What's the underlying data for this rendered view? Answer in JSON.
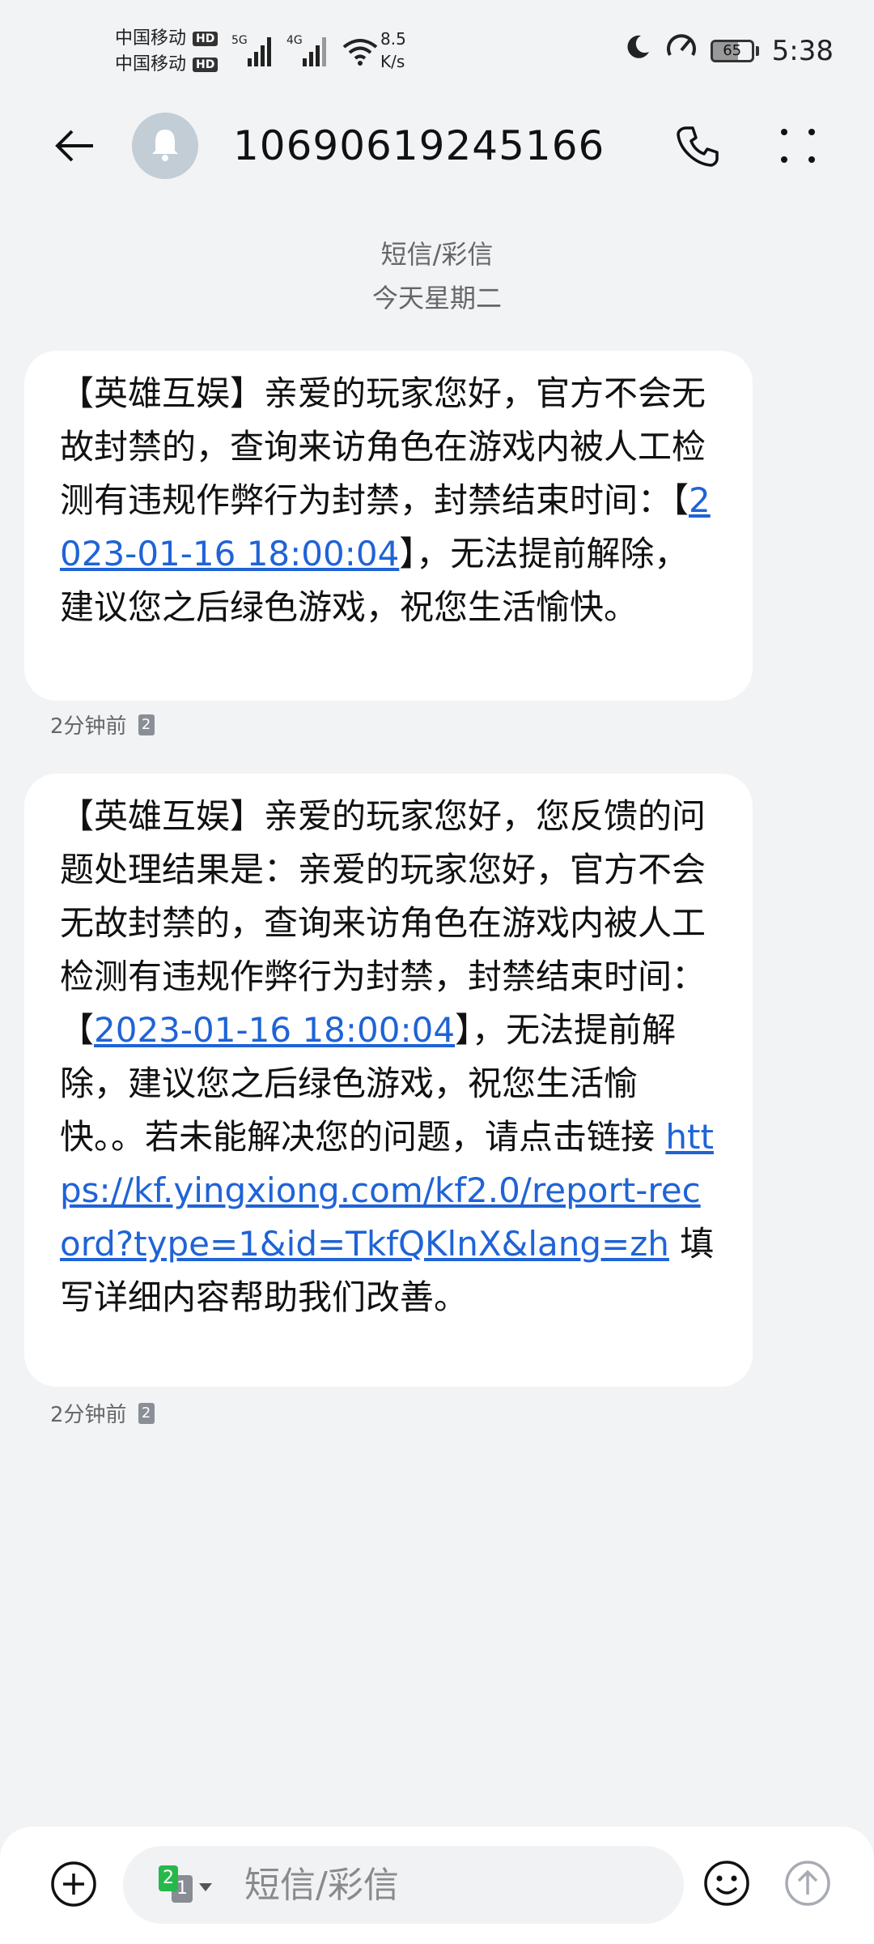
{
  "status_bar": {
    "carrier_1": "中国移动",
    "carrier_2": "中国移动",
    "hd_badge": "HD",
    "signal_1_type": "5G",
    "signal_2_type": "4G",
    "net_speed_value": "8.5",
    "net_speed_unit": "K/s",
    "battery_level": "65",
    "battery_level_fraction": 0.65,
    "time": "5:38"
  },
  "header": {
    "contact": "10690619245166"
  },
  "conversation": {
    "type_label": "短信/彩信",
    "date_label": "今天星期二"
  },
  "messages": [
    {
      "part1": "【英雄互娱】亲爱的玩家您好，官方不会无故封禁的，查询来访角色在游戏内被人工检测有违规作弊行为封禁，封禁结束时间：【",
      "link_date": "2023-01-16 18:00:04",
      "part2": "】，无法提前解除，建议您之后绿色游戏，祝您生活愉快。",
      "time": "2分钟前",
      "sim": "2"
    },
    {
      "part1": "【英雄互娱】亲爱的玩家您好，您反馈的问题处理结果是：亲爱的玩家您好，官方不会无故封禁的，查询来访角色在游戏内被人工检测有违规作弊行为封禁，封禁结束时间：【",
      "link_date": "2023-01-16 18:00:04",
      "part2": "】，无法提前解除，建议您之后绿色游戏，祝您生活愉快。。若未能解决您的问题，请点击链接 ",
      "link_url": "https://kf.yingxiong.com/kf2.0/report-record?type=1&id=TkfQKlnX&lang=zh",
      "part3": " 填写详细内容帮助我们改善。",
      "time": "2分钟前",
      "sim": "2"
    }
  ],
  "composer": {
    "placeholder": "短信/彩信",
    "sim_front": "2",
    "sim_back": "1"
  },
  "colors": {
    "background": "#f1f3f5",
    "bubble": "#ffffff",
    "link": "#1f63d6",
    "sim_green": "#27b84a"
  },
  "icons": {
    "back": "back-arrow-icon",
    "avatar": "bell-icon",
    "call": "phone-icon",
    "more": "more-dots-icon",
    "add": "plus-circle-icon",
    "emoji": "smiley-icon",
    "send": "send-up-arrow-icon",
    "moon": "moon-icon",
    "speed": "speedometer-icon",
    "wifi": "wifi-icon"
  }
}
